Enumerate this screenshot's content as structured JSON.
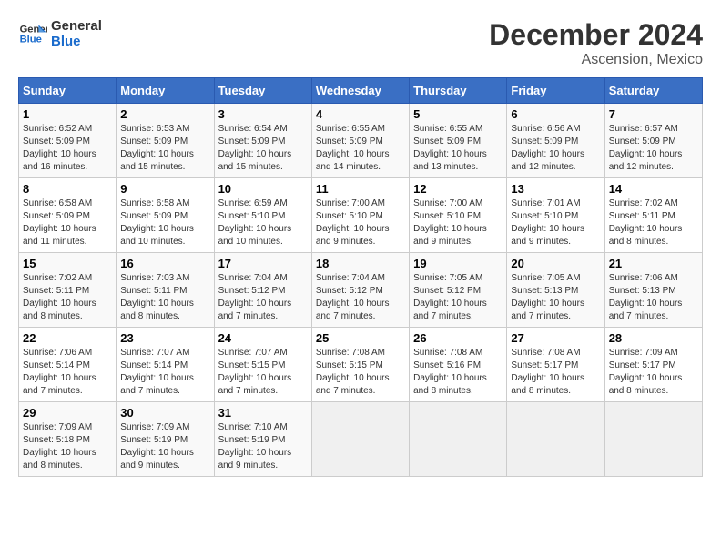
{
  "logo": {
    "line1": "General",
    "line2": "Blue"
  },
  "title": "December 2024",
  "subtitle": "Ascension, Mexico",
  "days_header": [
    "Sunday",
    "Monday",
    "Tuesday",
    "Wednesday",
    "Thursday",
    "Friday",
    "Saturday"
  ],
  "weeks": [
    [
      {
        "day": "1",
        "info": "Sunrise: 6:52 AM\nSunset: 5:09 PM\nDaylight: 10 hours\nand 16 minutes."
      },
      {
        "day": "2",
        "info": "Sunrise: 6:53 AM\nSunset: 5:09 PM\nDaylight: 10 hours\nand 15 minutes."
      },
      {
        "day": "3",
        "info": "Sunrise: 6:54 AM\nSunset: 5:09 PM\nDaylight: 10 hours\nand 15 minutes."
      },
      {
        "day": "4",
        "info": "Sunrise: 6:55 AM\nSunset: 5:09 PM\nDaylight: 10 hours\nand 14 minutes."
      },
      {
        "day": "5",
        "info": "Sunrise: 6:55 AM\nSunset: 5:09 PM\nDaylight: 10 hours\nand 13 minutes."
      },
      {
        "day": "6",
        "info": "Sunrise: 6:56 AM\nSunset: 5:09 PM\nDaylight: 10 hours\nand 12 minutes."
      },
      {
        "day": "7",
        "info": "Sunrise: 6:57 AM\nSunset: 5:09 PM\nDaylight: 10 hours\nand 12 minutes."
      }
    ],
    [
      {
        "day": "8",
        "info": "Sunrise: 6:58 AM\nSunset: 5:09 PM\nDaylight: 10 hours\nand 11 minutes."
      },
      {
        "day": "9",
        "info": "Sunrise: 6:58 AM\nSunset: 5:09 PM\nDaylight: 10 hours\nand 10 minutes."
      },
      {
        "day": "10",
        "info": "Sunrise: 6:59 AM\nSunset: 5:10 PM\nDaylight: 10 hours\nand 10 minutes."
      },
      {
        "day": "11",
        "info": "Sunrise: 7:00 AM\nSunset: 5:10 PM\nDaylight: 10 hours\nand 9 minutes."
      },
      {
        "day": "12",
        "info": "Sunrise: 7:00 AM\nSunset: 5:10 PM\nDaylight: 10 hours\nand 9 minutes."
      },
      {
        "day": "13",
        "info": "Sunrise: 7:01 AM\nSunset: 5:10 PM\nDaylight: 10 hours\nand 9 minutes."
      },
      {
        "day": "14",
        "info": "Sunrise: 7:02 AM\nSunset: 5:11 PM\nDaylight: 10 hours\nand 8 minutes."
      }
    ],
    [
      {
        "day": "15",
        "info": "Sunrise: 7:02 AM\nSunset: 5:11 PM\nDaylight: 10 hours\nand 8 minutes."
      },
      {
        "day": "16",
        "info": "Sunrise: 7:03 AM\nSunset: 5:11 PM\nDaylight: 10 hours\nand 8 minutes."
      },
      {
        "day": "17",
        "info": "Sunrise: 7:04 AM\nSunset: 5:12 PM\nDaylight: 10 hours\nand 7 minutes."
      },
      {
        "day": "18",
        "info": "Sunrise: 7:04 AM\nSunset: 5:12 PM\nDaylight: 10 hours\nand 7 minutes."
      },
      {
        "day": "19",
        "info": "Sunrise: 7:05 AM\nSunset: 5:12 PM\nDaylight: 10 hours\nand 7 minutes."
      },
      {
        "day": "20",
        "info": "Sunrise: 7:05 AM\nSunset: 5:13 PM\nDaylight: 10 hours\nand 7 minutes."
      },
      {
        "day": "21",
        "info": "Sunrise: 7:06 AM\nSunset: 5:13 PM\nDaylight: 10 hours\nand 7 minutes."
      }
    ],
    [
      {
        "day": "22",
        "info": "Sunrise: 7:06 AM\nSunset: 5:14 PM\nDaylight: 10 hours\nand 7 minutes."
      },
      {
        "day": "23",
        "info": "Sunrise: 7:07 AM\nSunset: 5:14 PM\nDaylight: 10 hours\nand 7 minutes."
      },
      {
        "day": "24",
        "info": "Sunrise: 7:07 AM\nSunset: 5:15 PM\nDaylight: 10 hours\nand 7 minutes."
      },
      {
        "day": "25",
        "info": "Sunrise: 7:08 AM\nSunset: 5:15 PM\nDaylight: 10 hours\nand 7 minutes."
      },
      {
        "day": "26",
        "info": "Sunrise: 7:08 AM\nSunset: 5:16 PM\nDaylight: 10 hours\nand 8 minutes."
      },
      {
        "day": "27",
        "info": "Sunrise: 7:08 AM\nSunset: 5:17 PM\nDaylight: 10 hours\nand 8 minutes."
      },
      {
        "day": "28",
        "info": "Sunrise: 7:09 AM\nSunset: 5:17 PM\nDaylight: 10 hours\nand 8 minutes."
      }
    ],
    [
      {
        "day": "29",
        "info": "Sunrise: 7:09 AM\nSunset: 5:18 PM\nDaylight: 10 hours\nand 8 minutes."
      },
      {
        "day": "30",
        "info": "Sunrise: 7:09 AM\nSunset: 5:19 PM\nDaylight: 10 hours\nand 9 minutes."
      },
      {
        "day": "31",
        "info": "Sunrise: 7:10 AM\nSunset: 5:19 PM\nDaylight: 10 hours\nand 9 minutes."
      },
      {
        "day": "",
        "info": ""
      },
      {
        "day": "",
        "info": ""
      },
      {
        "day": "",
        "info": ""
      },
      {
        "day": "",
        "info": ""
      }
    ]
  ]
}
